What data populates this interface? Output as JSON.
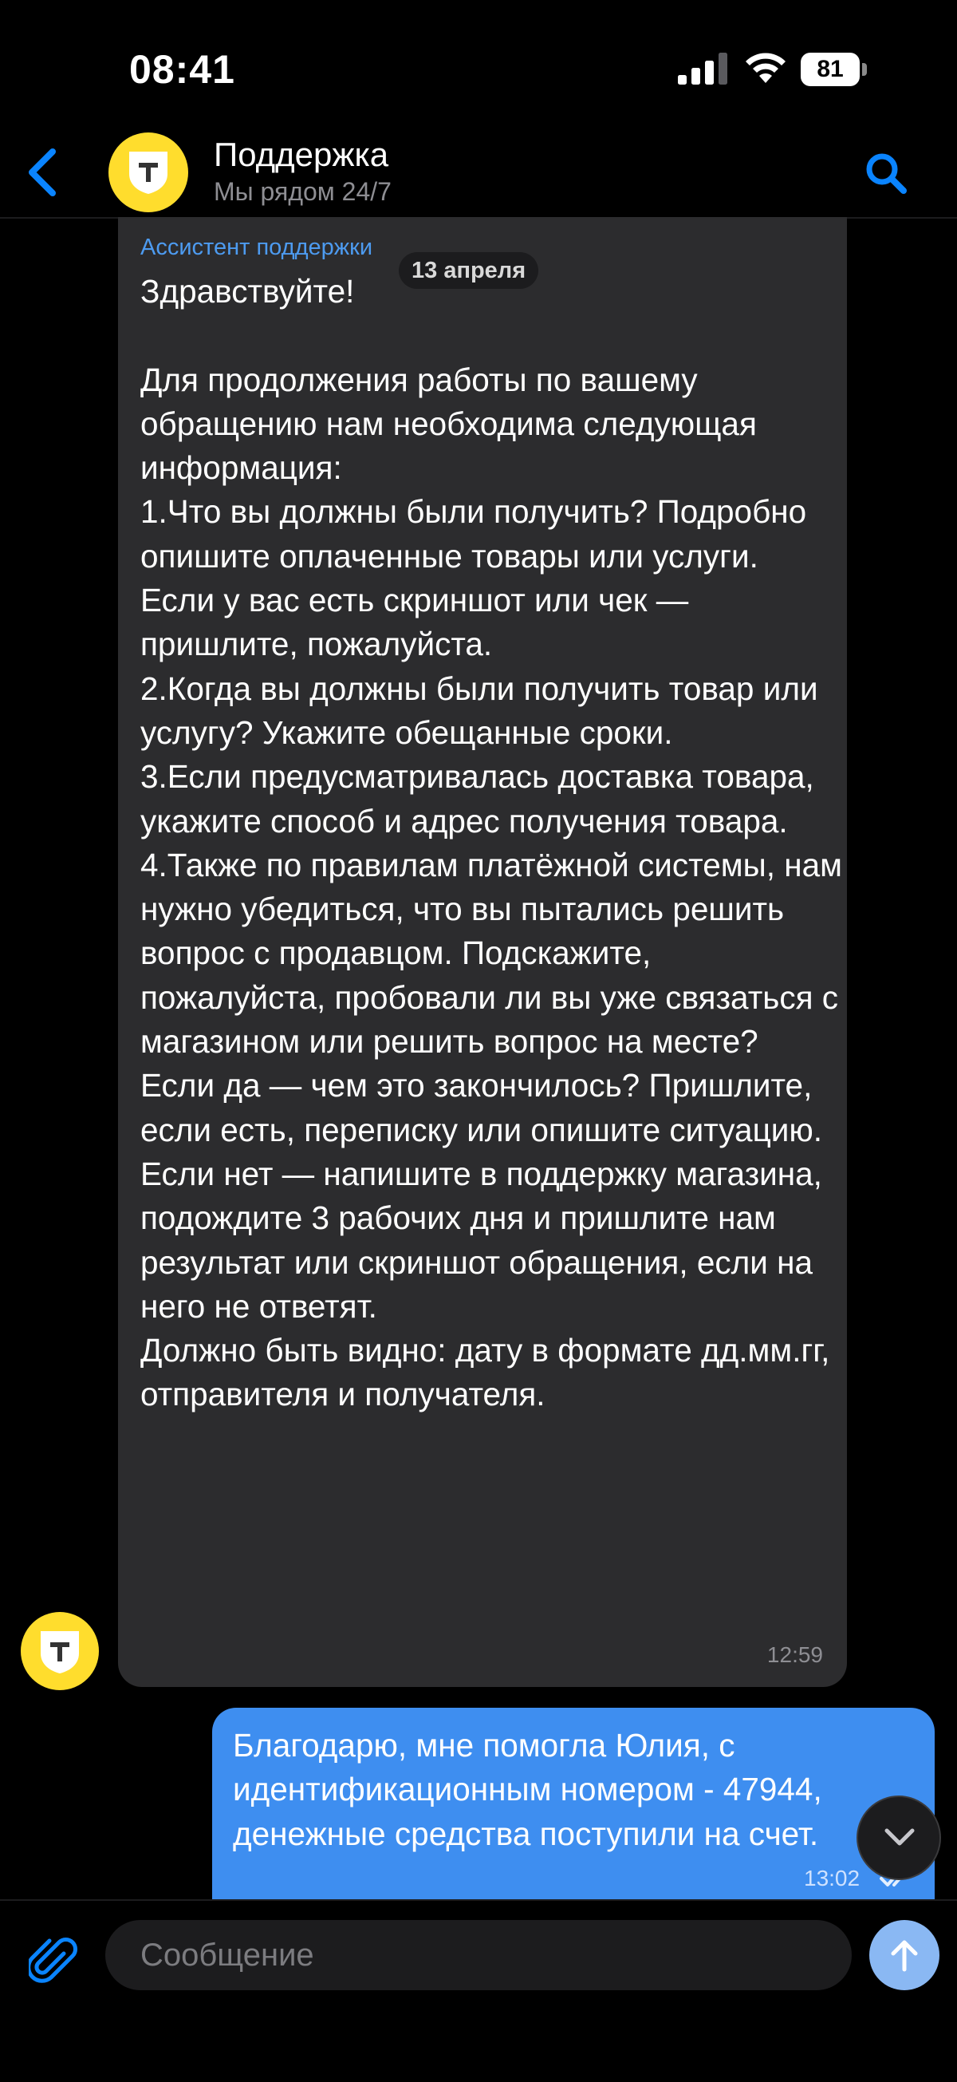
{
  "status_bar": {
    "time": "08:41",
    "battery": "81"
  },
  "header": {
    "title": "Поддержка",
    "subtitle": "Мы рядом 24/7",
    "back_icon": "chevron-left-icon",
    "search_icon": "search-icon",
    "avatar_icon": "bank-shield-logo-icon"
  },
  "date_chip": "13 апреля",
  "messages": [
    {
      "direction": "incoming",
      "sender": "Ассистент поддержки",
      "text": "Здравствуйте!\n\nДля продолжения работы по вашему обращению нам необходима следующая информация:\n1.Что вы должны были получить? Подробно опишите оплаченные товары или услуги.\nЕсли у вас есть скриншот или чек — пришлите, пожалуйста.\n2.Когда вы должны были получить товар или услугу? Укажите обещанные сроки.\n3.Если предусматривалась доставка товара, укажите способ и адрес получения товара.\n4.Также по правилам платёжной системы, нам нужно убедиться, что вы пытались решить вопрос с продавцом. Подскажите, пожалуйста, пробовали ли вы уже связаться с магазином или решить вопрос на месте?\nЕсли да — чем это закончилось? Пришлите, если есть, переписку или опишите ситуацию.\nЕсли нет — напишите в поддержку магазина, подождите 3 рабочих дня и пришлите нам результат или скриншот обращения, если на него не ответят.\nДолжно быть видно: дату в формате дд.мм.гг, отправителя и получателя.",
      "time": "12:59"
    },
    {
      "direction": "outgoing",
      "text": "Благодарю, мне помогла Юлия, с идентификационным номером  - 47944, денежные средства поступили на счет.",
      "time": "13:02",
      "status_icon": "double-check-icon"
    }
  ],
  "composer": {
    "placeholder": "Сообщение",
    "value": "",
    "attach_icon": "paperclip-icon",
    "send_icon": "arrow-up-icon"
  },
  "colors": {
    "background": "#000000",
    "incoming_bubble": "#2c2c2e",
    "outgoing_bubble": "#3e8ef0",
    "accent": "#0a84ff",
    "brand_yellow": "#ffdd2d"
  }
}
